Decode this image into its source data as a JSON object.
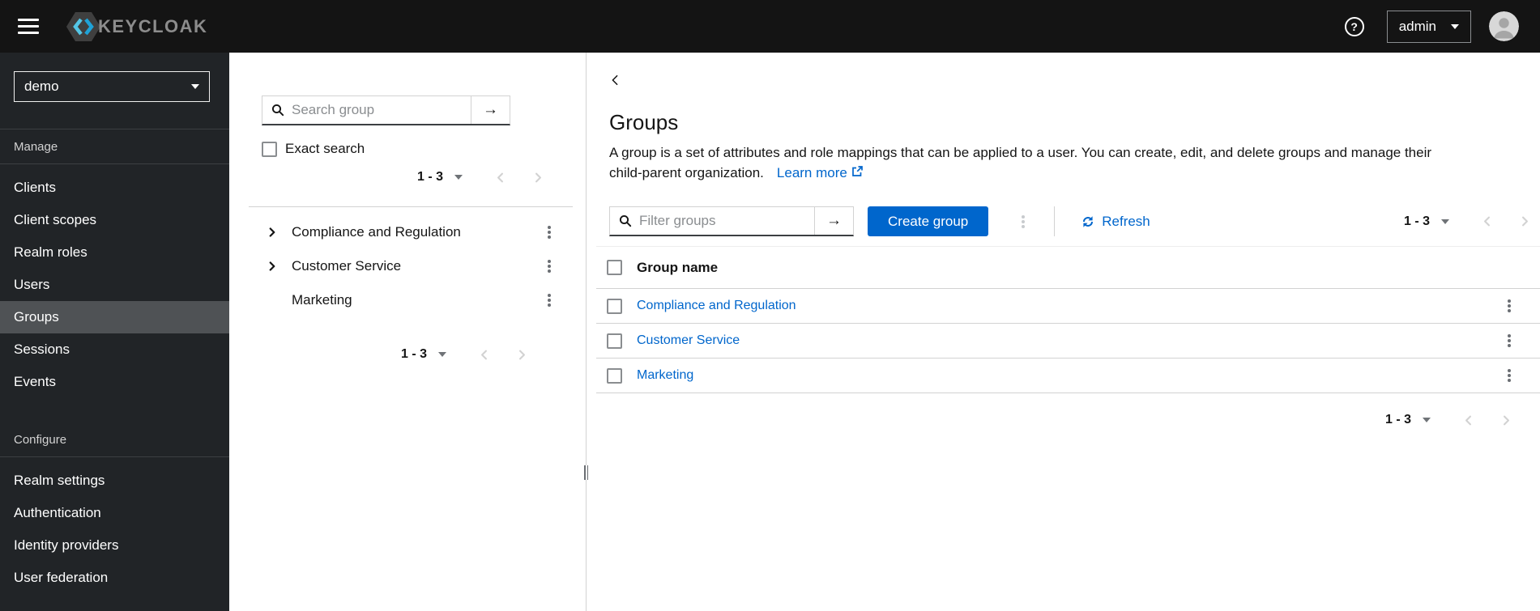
{
  "header": {
    "brand": "KEYCLOAK",
    "user_menu": {
      "label": "admin"
    }
  },
  "icons": {
    "help_glyph": "?",
    "submit_arrow": "→",
    "hamburger": "css-bars",
    "avatar": "svg-person-circle",
    "search": "svg-magnifier",
    "kebab": "css-vertical-dots",
    "refresh": "svg-sync-arrows",
    "external_link": "svg-box-arrow",
    "caret_down": "css-triangle"
  },
  "sidebar": {
    "realm_select": {
      "value": "demo"
    },
    "sections": [
      {
        "label": "Manage",
        "items": [
          "Clients",
          "Client scopes",
          "Realm roles",
          "Users",
          "Groups",
          "Sessions",
          "Events"
        ]
      },
      {
        "label": "Configure",
        "items": [
          "Realm settings",
          "Authentication",
          "Identity providers",
          "User federation"
        ]
      }
    ],
    "selected_item": "Groups"
  },
  "tree_panel": {
    "search": {
      "placeholder": "Search group"
    },
    "exact_search_label": "Exact search",
    "pagination_top": {
      "range": "1 - 3"
    },
    "items": [
      {
        "label": "Compliance and Regulation",
        "expandable": true
      },
      {
        "label": "Customer Service",
        "expandable": true
      },
      {
        "label": "Marketing",
        "expandable": false
      }
    ],
    "pagination_bottom": {
      "range": "1 - 3"
    }
  },
  "main": {
    "title": "Groups",
    "description_lines": [
      "A group is a set of attributes and role mappings that can be applied to a user. You can create, edit, and delete groups and manage their",
      "child-parent organization."
    ],
    "learn_more_label": "Learn more",
    "toolbar": {
      "filter_placeholder": "Filter groups",
      "create_button_label": "Create group",
      "refresh_label": "Refresh",
      "pagination": {
        "range": "1 - 3"
      }
    },
    "table": {
      "columns": [
        "Group name"
      ],
      "rows": [
        {
          "name": "Compliance and Regulation"
        },
        {
          "name": "Customer Service"
        },
        {
          "name": "Marketing"
        }
      ]
    },
    "bottom_pagination": {
      "range": "1 - 3"
    }
  },
  "colors": {
    "accent": "#0066cc",
    "link": "#0066cc",
    "header_bg": "#141414",
    "sidebar_bg": "#212427",
    "selected_nav_bg": "#4f5255",
    "border_light": "#d2d2d2",
    "disabled_chevron": "#d2d2d2"
  }
}
